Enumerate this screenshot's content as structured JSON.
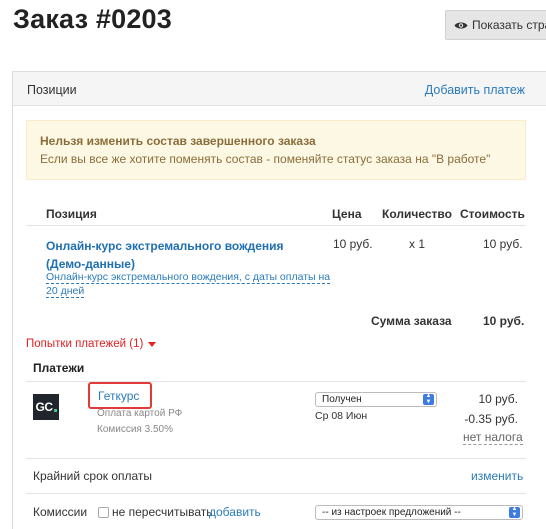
{
  "header": {
    "title": "Заказ #0203",
    "show_page_label": "Показать стра"
  },
  "positions_panel": {
    "title": "Позиции",
    "add_payment_label": "Добавить платеж"
  },
  "alert": {
    "title": "Нельзя изменить состав завершенного заказа",
    "text": "Если вы все же хотите поменять состав - поменяйте статус заказа на \"В работе\""
  },
  "table": {
    "headers": {
      "position": "Позиция",
      "price": "Цена",
      "quantity": "Количество",
      "cost": "Стоимость"
    },
    "rows": [
      {
        "name": "Онлайн-курс экстремального вождения (Демо-данные)",
        "sub": "Онлайн-курс экстремального вождения, с даты оплаты на 20 дней",
        "price": "10 руб.",
        "quantity": "x 1",
        "cost": "10 руб."
      }
    ],
    "total_label": "Сумма заказа",
    "total_value": "10 руб."
  },
  "payment_attempts_label": "Попытки платежей (1)",
  "payments": {
    "title": "Платежи",
    "items": [
      {
        "provider": "Геткурс",
        "logo_text": "GC",
        "method": "Оплата картой РФ",
        "commission": "Комиссия 3.50%",
        "status": "Получен",
        "date": "Ср 08 Июн",
        "amount": "10 руб.",
        "fee": "-0.35 руб.",
        "tax": "нет налога"
      }
    ]
  },
  "deadline": {
    "label": "Крайний срок оплаты",
    "change_label": "изменить"
  },
  "commissions": {
    "label": "Комиссии",
    "no_recalc_label": "не пересчитывать",
    "add_label": "добавить",
    "select_value": "-- из настроек предложений --"
  },
  "colors": {
    "link": "#2b7bb9",
    "alert_bg": "#fcf8e3",
    "alert_text": "#8a6d3b",
    "attempts": "#e02222",
    "highlight_box": "#e23a3a",
    "logo_bg": "#21262c"
  }
}
